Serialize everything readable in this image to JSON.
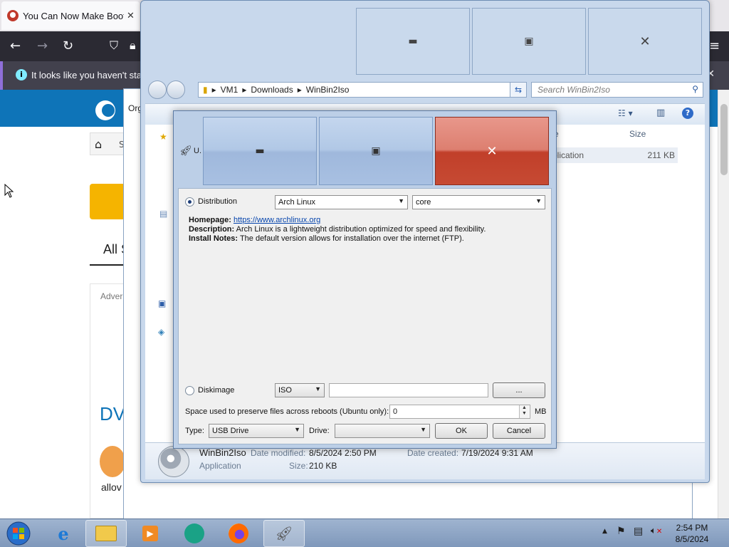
{
  "firefox": {
    "tab_title": "You Can Now Make Bootable",
    "tab_close": "✕",
    "infobar_text": "It looks like you haven't starte",
    "infobar_close": "✕",
    "site_partial": {
      "all": "All S",
      "adver": "Adver",
      "dv": "DV",
      "allov": "allov",
      "s": "S"
    }
  },
  "explorer": {
    "breadcrumb": [
      "VM1",
      "Downloads",
      "WinBin2Iso"
    ],
    "search_placeholder": "Search WinBin2Iso",
    "toolbar_organize": "Org",
    "columns": {
      "type_partial": "e",
      "size": "Size"
    },
    "row": {
      "type_partial": "plication",
      "size": "211 KB"
    },
    "status": {
      "name": "WinBin2Iso",
      "date_modified_label": "Date modified:",
      "date_modified": "8/5/2024 2:50 PM",
      "date_created_label": "Date created:",
      "date_created": "7/19/2024 9:31 AM",
      "type": "Application",
      "size_label": "Size:",
      "size": "210 KB"
    }
  },
  "dialog": {
    "title_partial": "U.",
    "distribution_label": "Distribution",
    "distribution_value": "Arch Linux",
    "variant_value": "core",
    "homepage_label": "Homepage:",
    "homepage_url": "https://www.archlinux.org",
    "description_label": "Description:",
    "description": "Arch Linux is a lightweight distribution optimized for speed and flexibility.",
    "install_label": "Install Notes:",
    "install_notes": "The default version allows for installation over the internet (FTP).",
    "diskimage_label": "Diskimage",
    "diskimage_format": "ISO",
    "diskimage_path": "",
    "browse_label": "...",
    "persist_label": "Space used to preserve files across reboots (Ubuntu only):",
    "persist_value": "0",
    "persist_unit": "MB",
    "type_label": "Type:",
    "type_value": "USB Drive",
    "drive_label": "Drive:",
    "drive_value": "",
    "ok_label": "OK",
    "cancel_label": "Cancel"
  },
  "taskbar": {
    "time": "2:54 PM",
    "date": "8/5/2024"
  }
}
